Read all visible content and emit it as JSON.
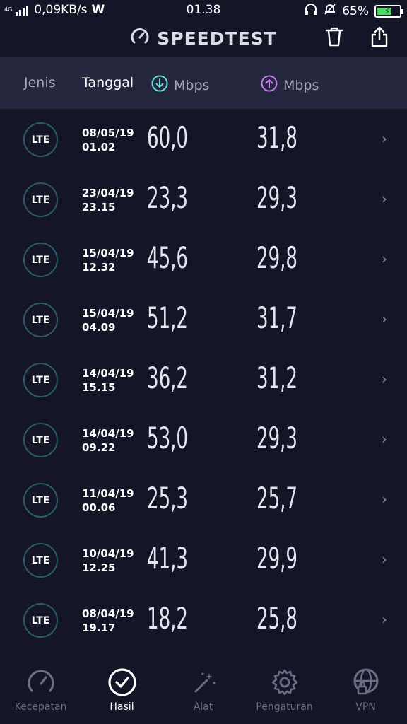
{
  "status_bar": {
    "network_type": "4G",
    "speed": "0,09KB/s",
    "time": "01.38",
    "battery": "65%",
    "battery_level": 0.65
  },
  "header": {
    "title": "SPEEDTEST"
  },
  "columns": {
    "type": "Jenis",
    "date": "Tanggal",
    "download": "Mbps",
    "upload": "Mbps"
  },
  "results": [
    {
      "type": "LTE",
      "date": "08/05/19",
      "time": "01.02",
      "download": "60,0",
      "upload": "31,8"
    },
    {
      "type": "LTE",
      "date": "23/04/19",
      "time": "23.15",
      "download": "23,3",
      "upload": "29,3"
    },
    {
      "type": "LTE",
      "date": "15/04/19",
      "time": "12.32",
      "download": "45,6",
      "upload": "29,8"
    },
    {
      "type": "LTE",
      "date": "15/04/19",
      "time": "04.09",
      "download": "51,2",
      "upload": "31,7"
    },
    {
      "type": "LTE",
      "date": "14/04/19",
      "time": "15.15",
      "download": "36,2",
      "upload": "31,2"
    },
    {
      "type": "LTE",
      "date": "14/04/19",
      "time": "09.22",
      "download": "53,0",
      "upload": "29,3"
    },
    {
      "type": "LTE",
      "date": "11/04/19",
      "time": "00.06",
      "download": "25,3",
      "upload": "25,7"
    },
    {
      "type": "LTE",
      "date": "10/04/19",
      "time": "12.25",
      "download": "41,3",
      "upload": "29,9"
    },
    {
      "type": "LTE",
      "date": "08/04/19",
      "time": "19.17",
      "download": "18,2",
      "upload": "25,8"
    }
  ],
  "nav": {
    "speed": "Kecepatan",
    "results": "Hasil",
    "tools": "Alat",
    "settings": "Pengaturan",
    "vpn": "VPN"
  },
  "colors": {
    "background": "#141526",
    "header_band": "#24273d",
    "download_accent": "#5ee0d4",
    "upload_accent": "#c77dea",
    "lte_ring": "#2b5c62"
  }
}
